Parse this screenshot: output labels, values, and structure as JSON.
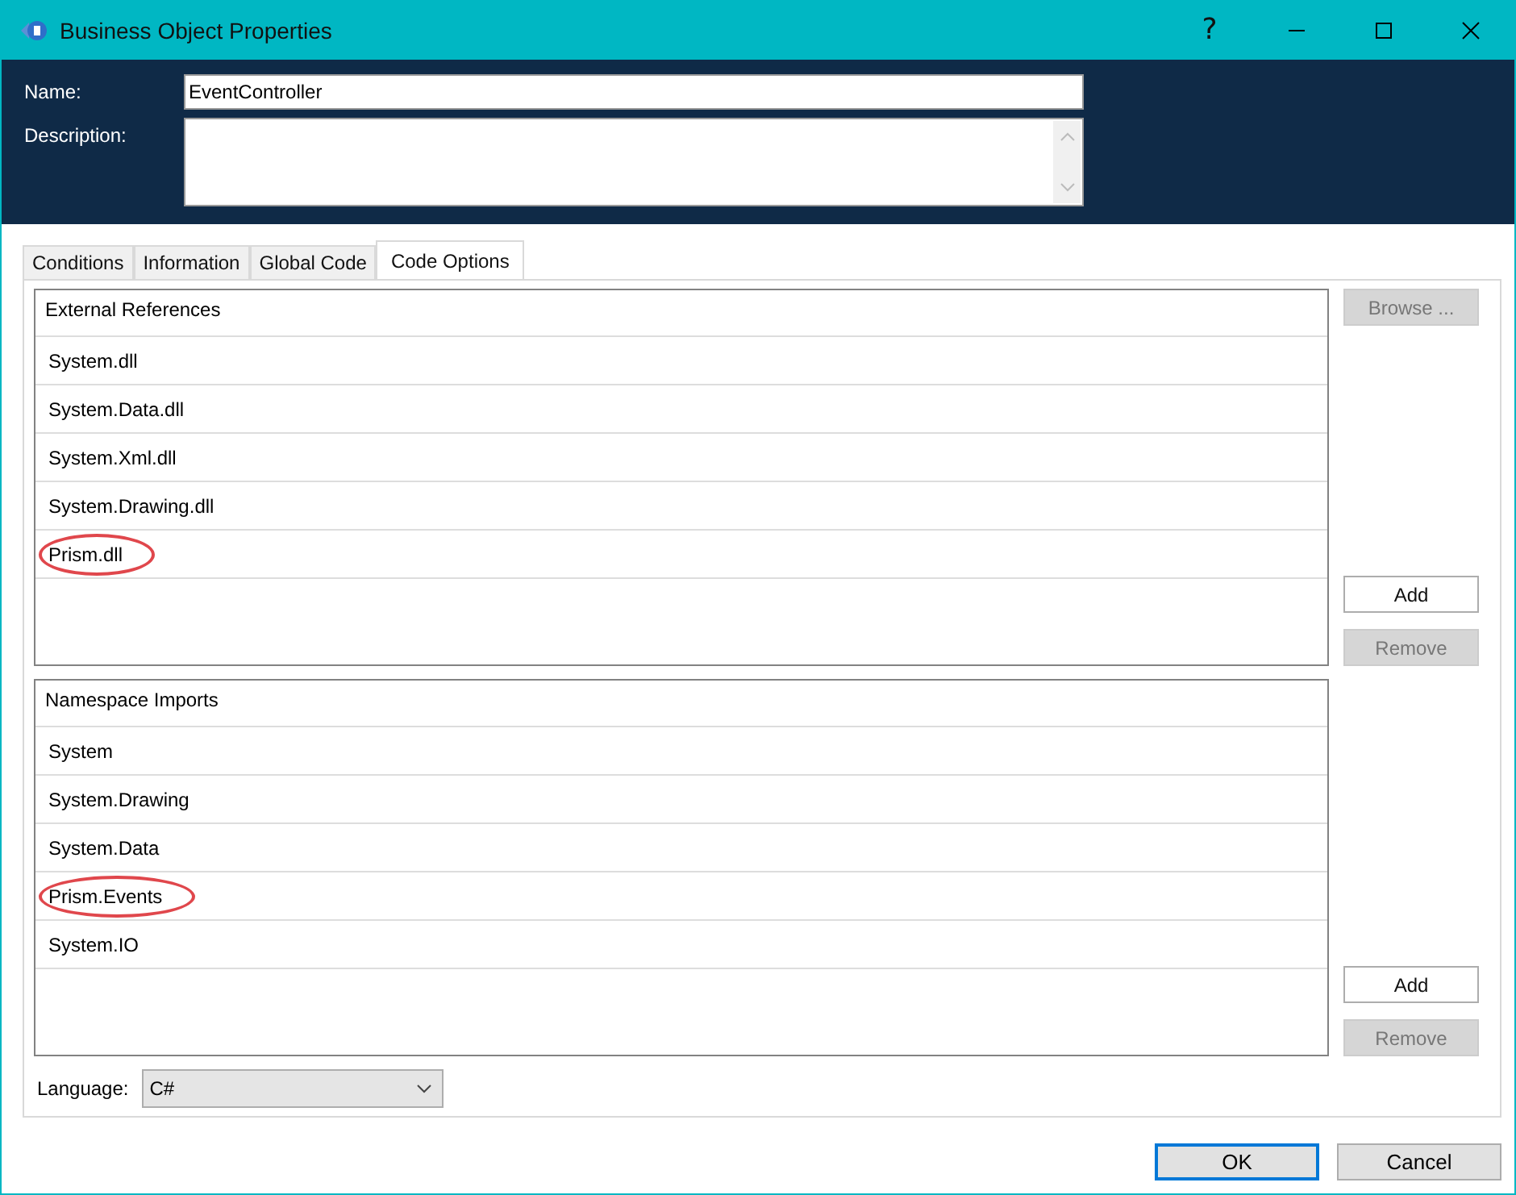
{
  "window": {
    "title": "Business Object Properties"
  },
  "title_buttons": [
    "?"
  ],
  "name_field": {
    "label": "Name:",
    "value": "EventController"
  },
  "description_field": {
    "label": "Description:"
  },
  "tabs": [
    {
      "label": "Conditions",
      "selected": false
    },
    {
      "label": "Information",
      "selected": false
    },
    {
      "label": "Global Code",
      "selected": false
    },
    {
      "label": "Code Options",
      "selected": true
    }
  ],
  "lists": [
    {
      "header": "External References",
      "items": [
        {
          "text": "System.dll",
          "highlighted": false
        },
        {
          "text": "System.Data.dll",
          "highlighted": false
        },
        {
          "text": "System.Xml.dll",
          "highlighted": false
        },
        {
          "text": "System.Drawing.dll",
          "highlighted": false
        },
        {
          "text": "Prism.dll",
          "highlighted": true
        }
      ],
      "top_buttons": [
        {
          "label": "Browse ...",
          "disabled": true
        }
      ],
      "bottom_buttons": [
        {
          "label": "Add",
          "disabled": false
        },
        {
          "label": "Remove",
          "disabled": true
        }
      ]
    },
    {
      "header": "Namespace Imports",
      "items": [
        {
          "text": "System",
          "highlighted": false
        },
        {
          "text": "System.Drawing",
          "highlighted": false
        },
        {
          "text": "System.Data",
          "highlighted": false
        },
        {
          "text": "Prism.Events",
          "highlighted": true
        },
        {
          "text": "System.IO",
          "highlighted": false
        }
      ],
      "bottom_buttons": [
        {
          "label": "Add",
          "disabled": false
        },
        {
          "label": "Remove",
          "disabled": true
        }
      ]
    }
  ],
  "language": {
    "label": "Language:",
    "value": "C#"
  },
  "dialog_buttons": [
    {
      "label": "OK",
      "default": true
    },
    {
      "label": "Cancel",
      "default": false
    }
  ]
}
